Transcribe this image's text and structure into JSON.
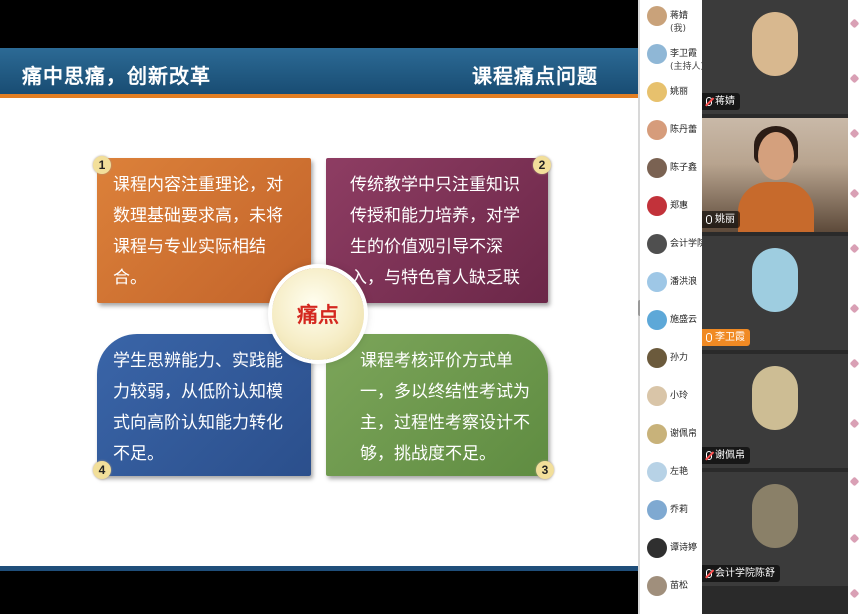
{
  "slide": {
    "title_left": "痛中思痛，创新改革",
    "title_right": "课程痛点问题",
    "center_label": "痛点",
    "points": [
      {
        "num": "1",
        "text": "课程内容注重理论，对数理基础要求高，未将课程与专业实际相结合。",
        "color": "#d67a36"
      },
      {
        "num": "2",
        "text": "传统教学中只注重知识传授和能力培养，对学生的价值观引导不深入，与特色育人缺乏联系。",
        "color": "#7e3357"
      },
      {
        "num": "3",
        "text": "课程考核评价方式单一，多以终结性考试为主，过程性考察设计不够，挑战度不足。",
        "color": "#6e9a4d"
      },
      {
        "num": "4",
        "text": "学生思辨能力、实践能力较弱，从低阶认知模式向高阶认知能力转化不足。",
        "color": "#335d9d"
      }
    ]
  },
  "participants": [
    {
      "name": "蒋婧",
      "sub": "(我)",
      "color": "#c9a27a"
    },
    {
      "name": "李卫霞",
      "sub": "(主持人)",
      "color": "#8fb7d6"
    },
    {
      "name": "姚丽",
      "sub": "",
      "color": "#e7c16d"
    },
    {
      "name": "陈丹蕾",
      "sub": "",
      "color": "#d69c7b"
    },
    {
      "name": "陈子鑫",
      "sub": "",
      "color": "#7a6252"
    },
    {
      "name": "郑惠",
      "sub": "",
      "color": "#c2323a"
    },
    {
      "name": "会计学院",
      "sub": "",
      "color": "#4f4f4f"
    },
    {
      "name": "潘洪浪",
      "sub": "",
      "color": "#9ec7e6"
    },
    {
      "name": "施盛云",
      "sub": "",
      "color": "#5da8d8"
    },
    {
      "name": "孙力",
      "sub": "",
      "color": "#6b5a3c"
    },
    {
      "name": "小玲",
      "sub": "",
      "color": "#d9c5a8"
    },
    {
      "name": "谢佩帛",
      "sub": "",
      "color": "#c8b27a"
    },
    {
      "name": "左艳",
      "sub": "",
      "color": "#b7d2e6"
    },
    {
      "name": "乔莉",
      "sub": "",
      "color": "#7fa9d1"
    },
    {
      "name": "谭诗婷",
      "sub": "",
      "color": "#2f2f2f"
    },
    {
      "name": "苗松",
      "sub": "",
      "color": "#a08f7c"
    }
  ],
  "video_tiles": [
    {
      "name": "蒋婧",
      "mic": "muted"
    },
    {
      "name": "姚丽",
      "mic": "on"
    },
    {
      "name": "李卫霞",
      "mic": "speaking"
    },
    {
      "name": "谢佩帛",
      "mic": "muted"
    },
    {
      "name": "会计学院陈舒",
      "mic": "muted"
    }
  ]
}
